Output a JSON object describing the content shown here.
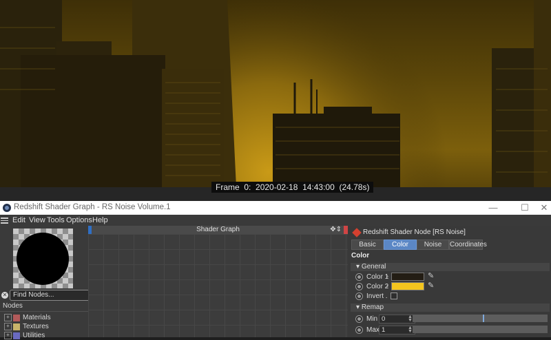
{
  "viewport": {
    "frame_info": "Frame  0:  2020-02-18  14:43:00  (24.78s)",
    "description_colors": {
      "sky": "#7c5f0c",
      "buildings": "#1f1a0c"
    }
  },
  "window": {
    "title": "Redshift Shader Graph - RS Noise Volume.1",
    "controls": {
      "minimize": "—",
      "maximize": "☐",
      "close": "✕"
    }
  },
  "menu": {
    "items": [
      "Edit",
      "View",
      "Tools",
      "Options",
      "Help"
    ]
  },
  "left_panel": {
    "find_placeholder": "Find Nodes...",
    "nodes_header": "Nodes",
    "tree": [
      {
        "label": "Materials",
        "color": "#b25a5a"
      },
      {
        "label": "Textures",
        "color": "#c9b46a"
      },
      {
        "label": "Utilities",
        "color": "#6a6ac0"
      }
    ]
  },
  "graph": {
    "title": "Shader Graph"
  },
  "attributes": {
    "node_title": "Redshift Shader Node [RS Noise]",
    "tabs": [
      {
        "label": "Basic",
        "active": false
      },
      {
        "label": "Color",
        "active": true
      },
      {
        "label": "Noise",
        "active": false
      },
      {
        "label": "Coordinates",
        "active": false
      }
    ],
    "section": "Color",
    "groups": {
      "general": "General",
      "remap": "Remap"
    },
    "color1": {
      "label": "Color 1",
      "value": "#231d14"
    },
    "color2": {
      "label": "Color 2",
      "value": "#f3c51f"
    },
    "invert": {
      "label": "Invert .",
      "checked": false
    },
    "min": {
      "label": "Min",
      "value": "0",
      "fraction": 0.52
    },
    "max": {
      "label": "Max",
      "value": "1",
      "fraction": 0.52
    }
  }
}
